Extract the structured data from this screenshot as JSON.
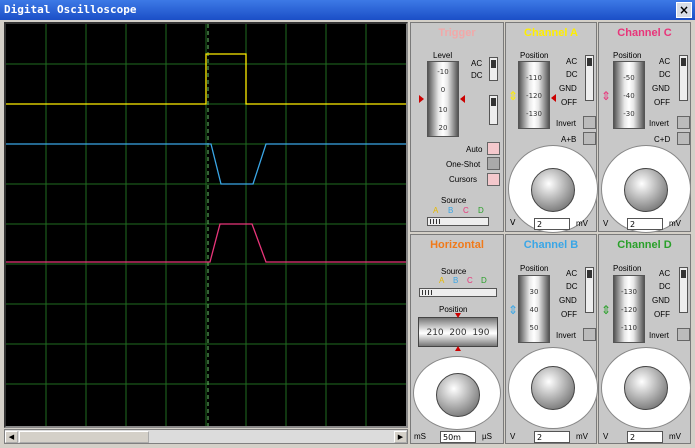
{
  "window": {
    "title": "Digital Oscilloscope",
    "close_label": "×"
  },
  "colors": {
    "channel_a": "#ffee00",
    "channel_b": "#3aa6e6",
    "channel_c": "#e8357a",
    "channel_d": "#2aa02a",
    "trigger": "#f2a8a8",
    "horizontal": "#f07a1a"
  },
  "trigger": {
    "title": "Trigger",
    "level_label": "Level",
    "ticks": [
      "-10",
      "0",
      "10",
      "20"
    ],
    "ac": "AC",
    "dc": "DC",
    "auto": "Auto",
    "one_shot": "One-Shot",
    "cursors": "Cursors",
    "source_label": "Source",
    "sources": [
      "A",
      "B",
      "C",
      "D"
    ]
  },
  "channel_a": {
    "title": "Channel A",
    "position_label": "Position",
    "ticks": [
      "-110",
      "-120",
      "-130"
    ],
    "ac": "AC",
    "dc": "DC",
    "gnd": "GND",
    "off": "OFF",
    "invert": "Invert",
    "combo": "A+B",
    "volts_unit": "V",
    "volts_value": "2",
    "mv_unit": "mV",
    "dial_ticks": [
      "0.5",
      "0.2",
      "0.1",
      "1",
      "2",
      "5",
      "10",
      "20",
      "50",
      "20",
      "10",
      "5",
      "2",
      "1"
    ]
  },
  "channel_c": {
    "title": "Channel C",
    "position_label": "Position",
    "ticks": [
      "-50",
      "-40",
      "-30"
    ],
    "ac": "AC",
    "dc": "DC",
    "gnd": "GND",
    "off": "OFF",
    "invert": "Invert",
    "combo": "C+D",
    "volts_unit": "V",
    "volts_value": "2",
    "mv_unit": "mV",
    "dial_ticks": [
      "0.5",
      "0.2",
      "0.1",
      "1",
      "2",
      "5",
      "10",
      "20",
      "50",
      "20",
      "10",
      "5",
      "2",
      "1"
    ]
  },
  "horizontal": {
    "title": "Horizontal",
    "source_label": "Source",
    "sources": [
      "A",
      "B",
      "C",
      "D"
    ],
    "position_label": "Position",
    "ruler": [
      "210",
      "200",
      "190"
    ],
    "unit_left": "mS",
    "value": "50m",
    "unit_right": "µS",
    "dial_ticks": [
      "0.5",
      "0.2",
      "0.1",
      "1",
      "2",
      "5",
      "10",
      "20",
      "50",
      "100",
      "200",
      "0.5",
      "1",
      "2",
      "5",
      "10",
      "20",
      "50"
    ]
  },
  "channel_b": {
    "title": "Channel B",
    "position_label": "Position",
    "ticks": [
      "30",
      "40",
      "50"
    ],
    "ac": "AC",
    "dc": "DC",
    "gnd": "GND",
    "off": "OFF",
    "invert": "Invert",
    "volts_unit": "V",
    "volts_value": "2",
    "mv_unit": "mV",
    "dial_ticks": [
      "0.5",
      "0.2",
      "0.1",
      "1",
      "2",
      "5",
      "10",
      "20",
      "50",
      "20",
      "10",
      "5",
      "2",
      "1"
    ]
  },
  "channel_d": {
    "title": "Channel D",
    "position_label": "Position",
    "ticks": [
      "-130",
      "-120",
      "-110"
    ],
    "ac": "AC",
    "dc": "DC",
    "gnd": "GND",
    "off": "OFF",
    "invert": "Invert",
    "volts_unit": "V",
    "volts_value": "2",
    "mv_unit": "mV",
    "dial_ticks": [
      "0.5",
      "0.2",
      "0.1",
      "1",
      "2",
      "5",
      "10",
      "20",
      "50",
      "20",
      "10",
      "5",
      "2",
      "1"
    ]
  }
}
